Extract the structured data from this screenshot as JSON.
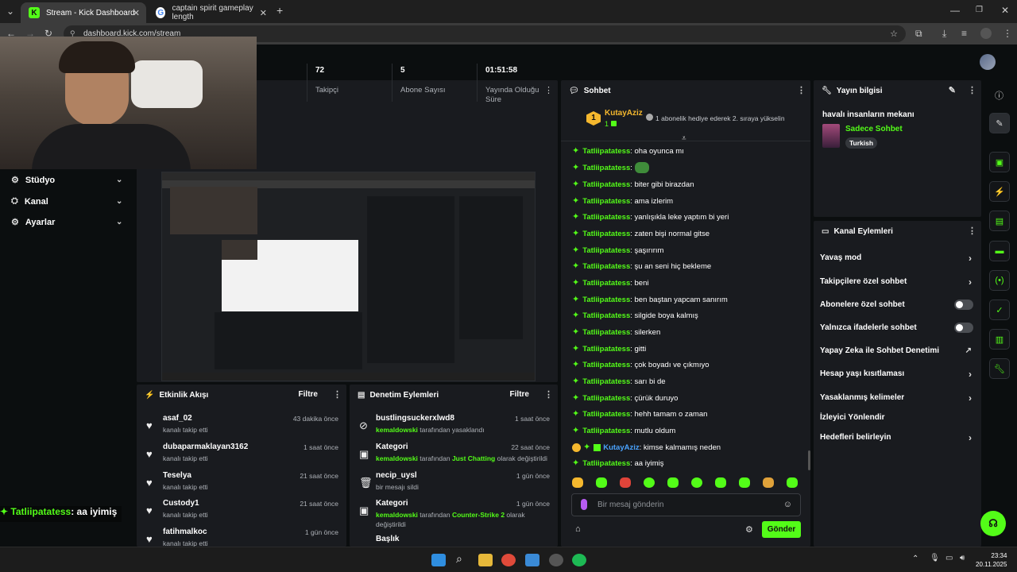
{
  "browser": {
    "tabs": [
      {
        "label": "Stream - Kick Dashboard"
      },
      {
        "label": "captain spirit gameplay length"
      }
    ],
    "url": "dashboard.kick.com/stream"
  },
  "nav": {
    "items": [
      {
        "label": "Stüdyo"
      },
      {
        "label": "Kanal"
      },
      {
        "label": "Ayarlar"
      }
    ]
  },
  "stats": [
    {
      "value": "72",
      "label": "Takipçi"
    },
    {
      "value": "5",
      "label": "Abone Sayısı"
    },
    {
      "value": "01:51:58",
      "label": "Yayında Olduğu Süre"
    }
  ],
  "overlay_chat": {
    "user": "Tatliipatatess",
    "message": ": aa iyimiş"
  },
  "activity": {
    "title": "Etkinlik Akışı",
    "filter": "Filtre",
    "events": [
      {
        "name": "asaf_02",
        "sub": "kanalı takip etti",
        "time": "43 dakika önce"
      },
      {
        "name": "dubaparmaklayan3162",
        "sub": "kanalı takip etti",
        "time": "1 saat önce"
      },
      {
        "name": "Teselya",
        "sub": "kanalı takip etti",
        "time": "21 saat önce"
      },
      {
        "name": "Custody1",
        "sub": "kanalı takip etti",
        "time": "21 saat önce"
      },
      {
        "name": "fatihmalkoc",
        "sub": "kanalı takip etti",
        "time": "1 gün önce"
      }
    ]
  },
  "moderation": {
    "title": "Denetim Eylemleri",
    "filter": "Filtre",
    "events": [
      {
        "name": "bustlingsuckerxlwd8",
        "actor": "kemaldowski",
        "rest": " tarafından yasaklandı",
        "extra": "",
        "extra2": "",
        "time": "1 saat önce"
      },
      {
        "name": "Kategori",
        "actor": "kemaldowski",
        "rest": " tarafından ",
        "extra": "Just Chatting",
        "extra2": " olarak değiştirildi",
        "time": "22 saat önce"
      },
      {
        "name": "necip_uysl",
        "actor": "",
        "rest": "bir mesajı sildi",
        "extra": "",
        "extra2": "",
        "time": "1 gün önce"
      },
      {
        "name": "Kategori",
        "actor": "kemaldowski",
        "rest": " tarafından ",
        "extra": "Counter-Strike 2",
        "extra2": " olarak",
        "time": "1 gün önce",
        "line2": "değiştirildi"
      },
      {
        "name": "Başlık",
        "actor": "",
        "rest": "",
        "extra": "",
        "extra2": "",
        "time": ""
      }
    ]
  },
  "chat": {
    "title": "Sohbet",
    "top_gifter": {
      "rank": "1",
      "name": "KutayAziz",
      "count": "1",
      "note": "1 abonelik hediye ederek 2. sıraya yükselin"
    },
    "messages": [
      {
        "user": "Tatliipatatess",
        "text": ": oha oyunca mı"
      },
      {
        "user": "Tatliipatatess",
        "text": ": "
      },
      {
        "user": "Tatliipatatess",
        "text": ": biter gibi birazdan"
      },
      {
        "user": "Tatliipatatess",
        "text": ": ama izlerim"
      },
      {
        "user": "Tatliipatatess",
        "text": ": yanlışıkla leke yaptım bi yeri"
      },
      {
        "user": "Tatliipatatess",
        "text": ": zaten bişi normal gitse"
      },
      {
        "user": "Tatliipatatess",
        "text": ": şaşırırım"
      },
      {
        "user": "Tatliipatatess",
        "text": ": şu an seni hiç bekleme"
      },
      {
        "user": "Tatliipatatess",
        "text": ": beni"
      },
      {
        "user": "Tatliipatatess",
        "text": ": ben baştan yapcam sanırım"
      },
      {
        "user": "Tatliipatatess",
        "text": ": silgide boya kalmış"
      },
      {
        "user": "Tatliipatatess",
        "text": ": silerken"
      },
      {
        "user": "Tatliipatatess",
        "text": ": gitti"
      },
      {
        "user": "Tatliipatatess",
        "text": ": çok boyadı ve çıkmıyo"
      },
      {
        "user": "Tatliipatatess",
        "text": ": sarı bi de"
      },
      {
        "user": "Tatliipatatess",
        "text": ": çürük duruyo"
      },
      {
        "user": "Tatliipatatess",
        "text": ": hehh tamam o zaman"
      },
      {
        "user": "Tatliipatatess",
        "text": ": mutlu oldum"
      },
      {
        "user": "KutayAziz",
        "text": ": kimse kalmamış neden"
      },
      {
        "user": "Tatliipatatess",
        "text": ": aa iyimiş"
      }
    ],
    "placeholder": "Bir mesaj gönderin",
    "send": "Gönder"
  },
  "stream_info": {
    "title": "Yayın bilgisi",
    "stream_title": "havalı insanların mekanı",
    "category": "Sadece Sohbet",
    "tag": "Turkish"
  },
  "channel_actions": {
    "title": "Kanal Eylemleri",
    "items": [
      {
        "label": "Yavaş mod",
        "type": "arrow"
      },
      {
        "label": "Takipçilere özel sohbet",
        "type": "arrow"
      },
      {
        "label": "Abonelere özel sohbet",
        "type": "toggle"
      },
      {
        "label": "Yalnızca ifadelerle sohbet",
        "type": "toggle"
      },
      {
        "label": "Yapay Zeka ile Sohbet Denetimi",
        "type": "external"
      },
      {
        "label": "Hesap yaşı kısıtlaması",
        "type": "arrow"
      },
      {
        "label": "Yasaklanmış kelimeler",
        "type": "arrow"
      },
      {
        "label": "İzleyici Yönlendir",
        "type": "none"
      },
      {
        "label": "Hedefleri belirleyin",
        "type": "arrow"
      }
    ]
  },
  "taskbar": {
    "time": "23:34",
    "date": "20.11.2025"
  },
  "colors": {
    "accent": "#53fc18",
    "panel": "#191b1f",
    "background": "#0b0e0f"
  }
}
